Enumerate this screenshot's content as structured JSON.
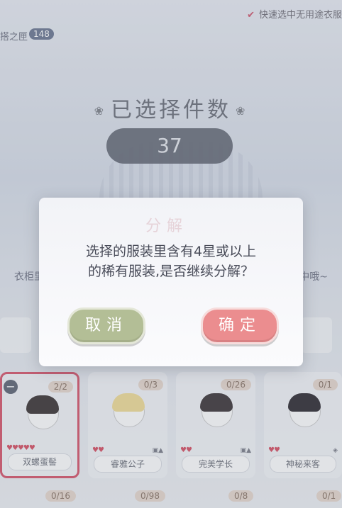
{
  "topbar": {
    "hanger_label": "搭之匣",
    "hanger_count": "148",
    "quick_select": "快速选中无用途衣服"
  },
  "selection": {
    "title": "已选择件数",
    "count": "37"
  },
  "background_hint": {
    "left": "衣柜里只有",
    "right": "中哦~"
  },
  "cards": [
    {
      "name": "双螺蛋髻",
      "fraction": "2/2",
      "hearts": "♥♥♥♥♥",
      "selected": true
    },
    {
      "name": "睿雅公子",
      "fraction": "0/3",
      "hearts": "♥♥"
    },
    {
      "name": "完美学长",
      "fraction": "0/26",
      "hearts": "♥♥"
    },
    {
      "name": "神秘来客",
      "fraction": "0/1",
      "hearts": "♥♥"
    }
  ],
  "row2_fractions": [
    "0/16",
    "0/98",
    "0/8",
    "0/1"
  ],
  "dialog": {
    "ghost_title": "分解",
    "message_line1": "选择的服装里含有4星或以上",
    "message_line2": "的稀有服装,是否继续分解？",
    "cancel_label": "取消",
    "ok_label": "确定"
  },
  "colors": {
    "cancel": "#b3be96",
    "confirm": "#eb8d8f",
    "selected_border": "#d6546a"
  }
}
